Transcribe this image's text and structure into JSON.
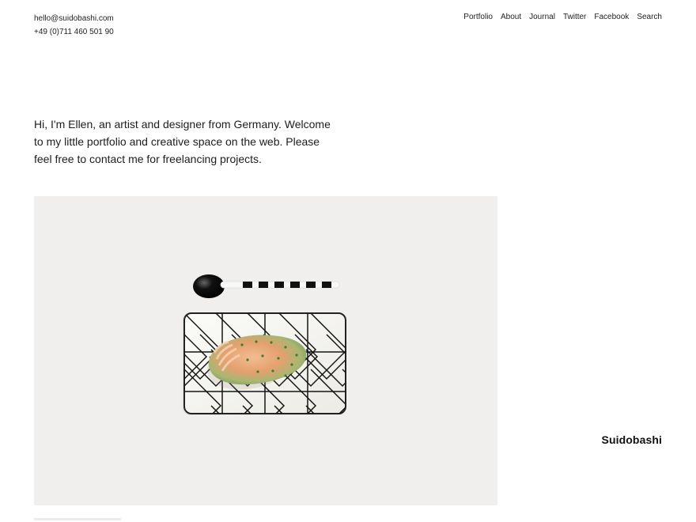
{
  "header": {
    "email": "hello@suidobashi.com",
    "phone": "+49 (0)711 460 501 90"
  },
  "nav": {
    "items": [
      "Portfolio",
      "About",
      "Journal",
      "Twitter",
      "Facebook",
      "Search"
    ]
  },
  "intro": {
    "text": "Hi, I'm Ellen, an artist and designer from Germany. Welcome to my little portfolio and creative space on the web. Please feel free to contact me for freelancing projects."
  },
  "brand": {
    "name": "Suidobashi"
  },
  "colors": {
    "background": "#ffffff",
    "text": "#1b1b1b",
    "hero_background": "#f0efee"
  }
}
